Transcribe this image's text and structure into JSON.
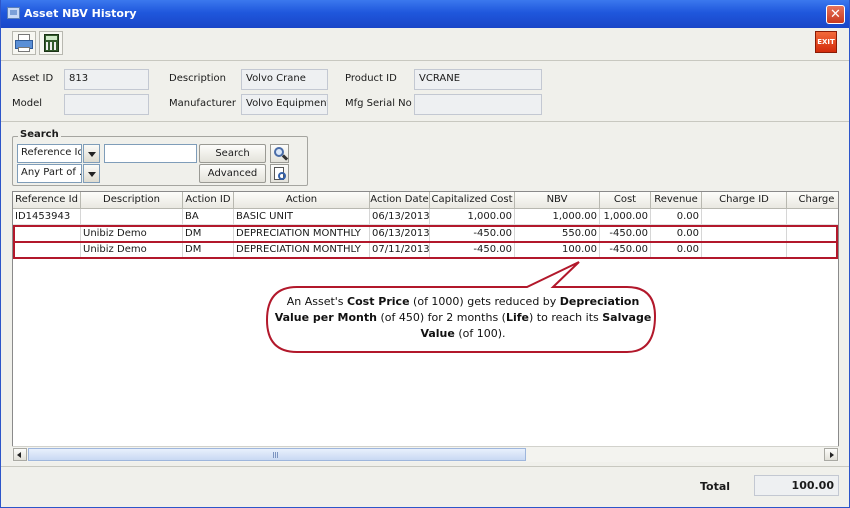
{
  "window": {
    "title": "Asset NBV History",
    "close_label": "✕"
  },
  "toolbar": {
    "exit_label": "EXIT"
  },
  "info": {
    "asset_id_label": "Asset ID",
    "asset_id": "813",
    "description_label": "Description",
    "description": "Volvo Crane",
    "product_id_label": "Product ID",
    "product_id": "VCRANE",
    "model_label": "Model",
    "model": "",
    "manufacturer_label": "Manufacturer",
    "manufacturer": "Volvo Equipment",
    "mfg_serial_label": "Mfg Serial No",
    "mfg_serial": ""
  },
  "search": {
    "title": "Search",
    "field_select": "Reference Id",
    "mode_select": "Any Part of ...",
    "query": "",
    "search_label": "Search",
    "advanced_label": "Advanced"
  },
  "table": {
    "columns": [
      "Reference Id",
      "Description",
      "Action ID",
      "Action",
      "Action Date",
      "Capitalized Cost",
      "NBV",
      "Cost",
      "Revenue",
      "Charge ID",
      "Charge"
    ],
    "rows": [
      [
        "ID1453943",
        "",
        "BA",
        "BASIC UNIT",
        "06/13/2013",
        "1,000.00",
        "1,000.00",
        "1,000.00",
        "0.00",
        "",
        ""
      ],
      [
        "",
        "Unibiz Demo",
        "DM",
        "DEPRECIATION MONTHLY",
        "06/13/2013",
        "-450.00",
        "550.00",
        "-450.00",
        "0.00",
        "",
        ""
      ],
      [
        "",
        "Unibiz Demo",
        "DM",
        "DEPRECIATION MONTHLY",
        "07/11/2013",
        "-450.00",
        "100.00",
        "-450.00",
        "0.00",
        "",
        ""
      ]
    ]
  },
  "callout": {
    "p1": "An Asset's ",
    "b1": "Cost Price",
    "p2": " (of 1000) gets reduced by ",
    "b2": "Depreciation Value per Month",
    "p3": " (of 450) for 2 months (",
    "b3": "Life",
    "p4": ") to reach its ",
    "b4": "Salvage Value",
    "p5": " (of 100)."
  },
  "footer": {
    "total_label": "Total",
    "total_value": "100.00"
  }
}
